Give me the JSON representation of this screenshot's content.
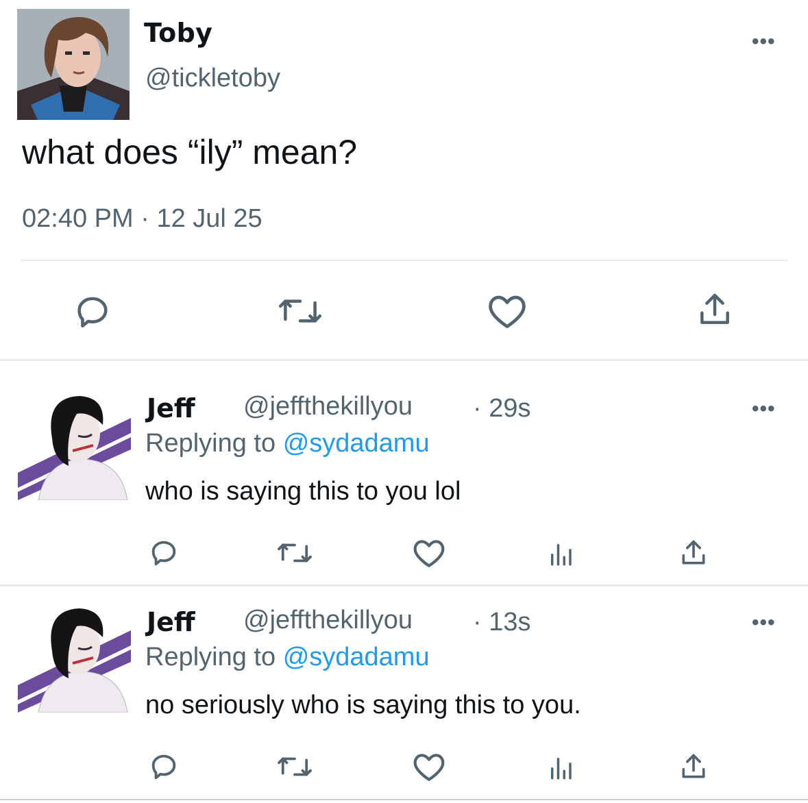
{
  "main_tweet": {
    "name": "Toby",
    "handle": "@tickletoby",
    "text": "what does “ily” mean?",
    "time": "02:40 PM",
    "separator": "·",
    "date": "12 Jul 25",
    "more": "•••"
  },
  "replies": [
    {
      "name": "Jeff",
      "handle": "@jeffthekillyou",
      "time": "· 29s",
      "replying_prefix": "Replying to",
      "replying_to": "@sydadamu",
      "text": "who is saying this to you lol",
      "more": "•••"
    },
    {
      "name": "Jeff",
      "handle": "@jeffthekillyou",
      "time": "· 13s",
      "replying_prefix": "Replying to",
      "replying_to": "@sydadamu",
      "text": "no seriously who is saying this to you.",
      "more": "•••"
    }
  ],
  "icons": {
    "reply": "reply-icon",
    "retweet": "retweet-icon",
    "like": "like-icon",
    "views": "views-icon",
    "share": "share-icon"
  },
  "colors": {
    "text": "#0f1419",
    "secondary": "#536471",
    "link": "#1d9bf0",
    "divider": "#e6ecf0"
  }
}
